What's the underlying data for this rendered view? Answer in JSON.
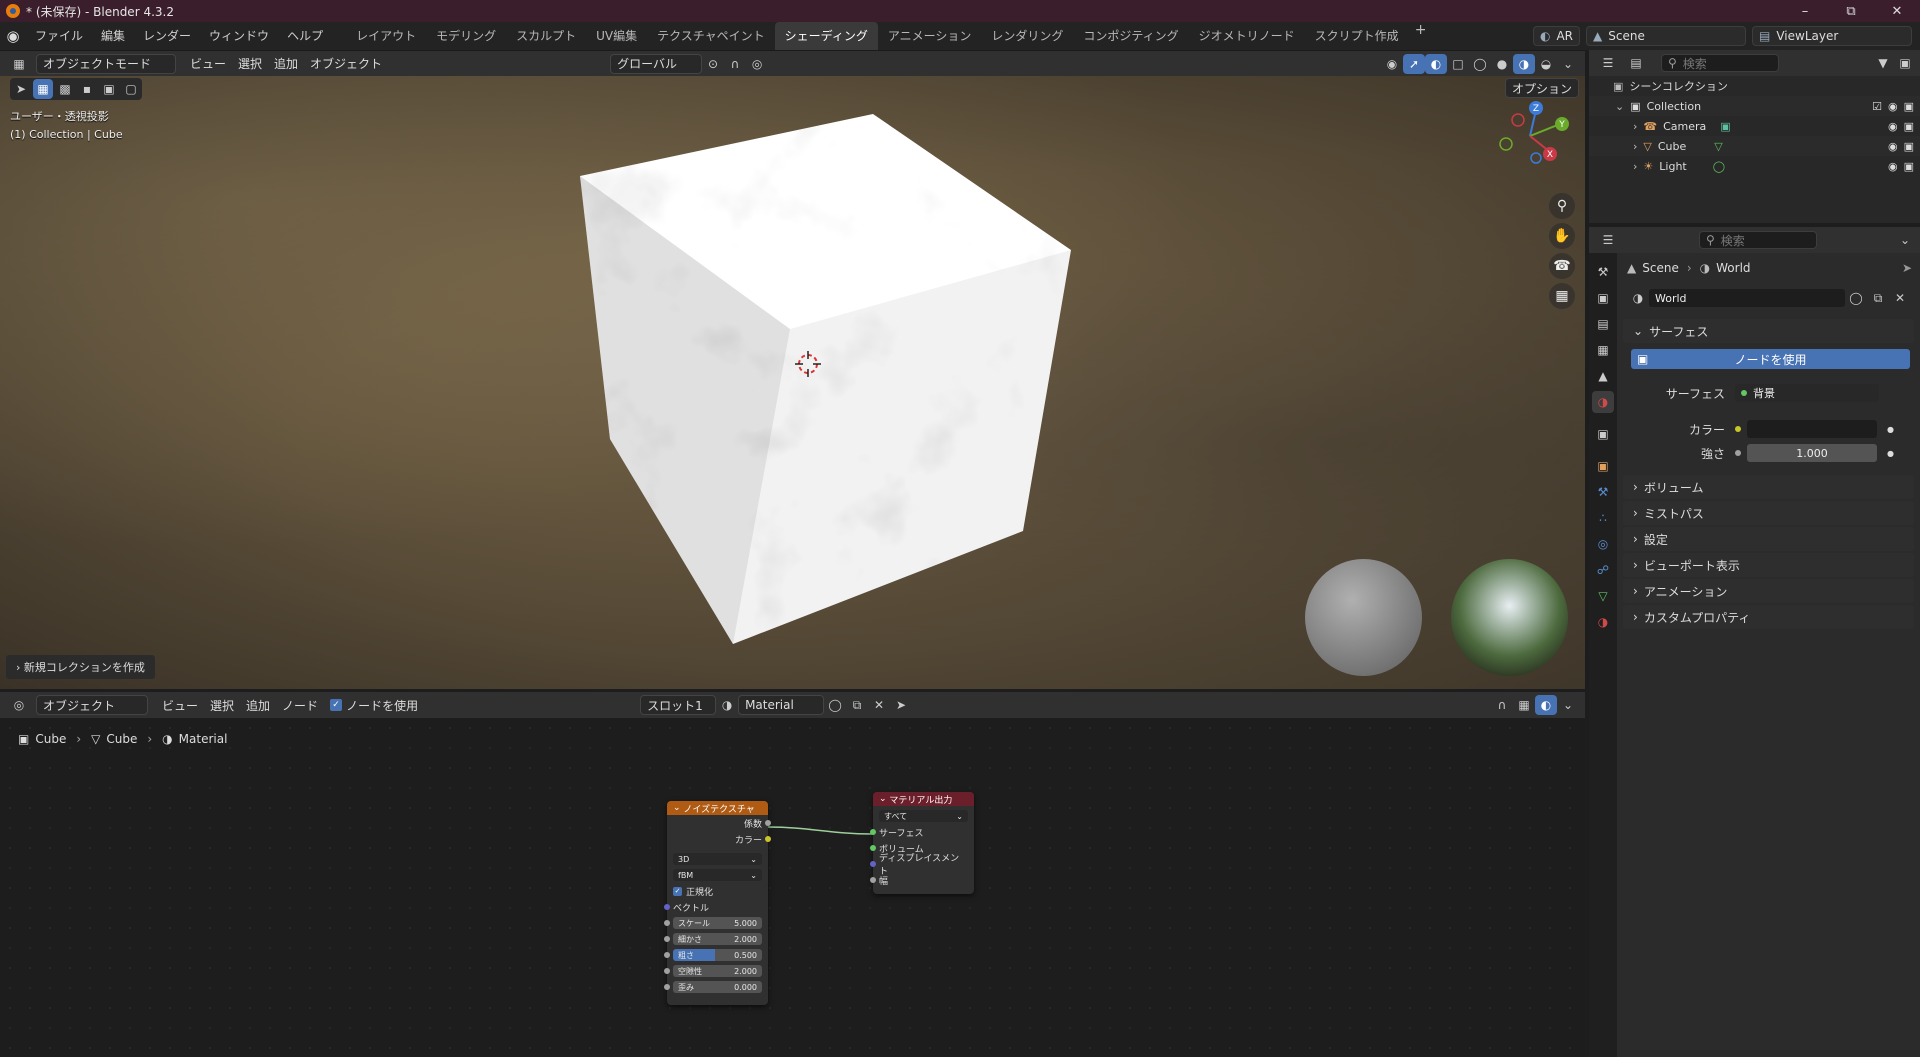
{
  "window": {
    "title": "* (未保存) - Blender 4.3.2"
  },
  "menu": [
    "ファイル",
    "編集",
    "レンダー",
    "ウィンドウ",
    "ヘルプ"
  ],
  "workspaces": [
    "レイアウト",
    "モデリング",
    "スカルプト",
    "UV編集",
    "テクスチャペイント",
    "シェーディング",
    "アニメーション",
    "レンダリング",
    "コンポジティング",
    "ジオメトリノード",
    "スクリプト作成"
  ],
  "active_workspace": "シェーディング",
  "topbar_right": {
    "ar": "AR",
    "scene": "Scene",
    "view_layer": "ViewLayer"
  },
  "viewport_header": {
    "mode": "オブジェクトモード",
    "menus": [
      "ビュー",
      "選択",
      "追加",
      "オブジェクト"
    ],
    "orientation": "グローバル",
    "options": "オプション"
  },
  "viewport": {
    "view_name": "ユーザー・透視投影",
    "collection_info": "(1) Collection | Cube",
    "new_collection": "新規コレクションを作成",
    "gizmo_axes": [
      "Z",
      "Y",
      "X"
    ]
  },
  "node_header": {
    "type": "オブジェクト",
    "menus": [
      "ビュー",
      "選択",
      "追加",
      "ノード"
    ],
    "use_nodes": "ノードを使用",
    "slot": "スロット1",
    "material": "Material"
  },
  "breadcrumb": [
    "Cube",
    "Cube",
    "Material"
  ],
  "noise_node": {
    "title": "ノイズテクスチャ",
    "outputs": [
      "係数",
      "カラー"
    ],
    "dimension": "3D",
    "type": "fBM",
    "normalize": "正規化",
    "vector": "ベクトル",
    "params": [
      {
        "label": "スケール",
        "value": "5.000"
      },
      {
        "label": "細かさ",
        "value": "2.000"
      },
      {
        "label": "粗さ",
        "value": "0.500"
      },
      {
        "label": "空隙性",
        "value": "2.000"
      },
      {
        "label": "歪み",
        "value": "0.000"
      }
    ]
  },
  "output_node": {
    "title": "マテリアル出力",
    "target": "すべて",
    "inputs": [
      "サーフェス",
      "ボリューム",
      "ディスプレイスメント",
      "幅"
    ]
  },
  "outliner": {
    "search_placeholder": "検索",
    "root": "シーンコレクション",
    "collection": "Collection",
    "items": [
      "Camera",
      "Cube",
      "Light"
    ]
  },
  "properties": {
    "search_placeholder": "検索",
    "breadcrumb": [
      "Scene",
      "World"
    ],
    "world_name": "World",
    "surface_panel": "サーフェス",
    "use_nodes_button": "ノードを使用",
    "surface_label": "サーフェス",
    "surface_value": "背景",
    "color_label": "カラー",
    "strength_label": "強さ",
    "strength_value": "1.000",
    "panels": [
      "ボリューム",
      "ミストパス",
      "設定",
      "ビューポート表示",
      "アニメーション",
      "カスタムプロパティ"
    ]
  },
  "colors": {
    "accent": "#4772b3",
    "noise_header": "#b05b14",
    "output_header": "#6b1f2b",
    "socket_gray": "#a1a1a1",
    "socket_yellow": "#c7c729",
    "socket_green": "#63c763",
    "socket_blue": "#6363c7"
  }
}
